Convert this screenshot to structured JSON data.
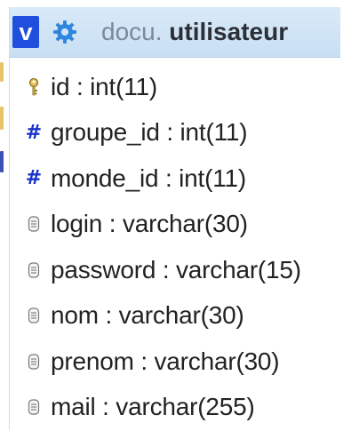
{
  "header": {
    "toggle_label": "v",
    "database": "docu.",
    "table": "utilisateur"
  },
  "columns": [
    {
      "text": "id : int(11)",
      "icon": "key-icon"
    },
    {
      "text": "groupe_id : int(11)",
      "icon": "numeric-icon"
    },
    {
      "text": "monde_id : int(11)",
      "icon": "numeric-icon"
    },
    {
      "text": "login : varchar(30)",
      "icon": "text-field-icon"
    },
    {
      "text": "password : varchar(15)",
      "icon": "text-field-icon"
    },
    {
      "text": "nom : varchar(30)",
      "icon": "text-field-icon"
    },
    {
      "text": "prenom : varchar(30)",
      "icon": "text-field-icon"
    },
    {
      "text": "mail : varchar(255)",
      "icon": "text-field-icon"
    }
  ],
  "colors": {
    "header_bg": "#c8dff3",
    "toggle_bg": "#1f4fdc",
    "gear": "#2f86de",
    "numeric": "#1a33c8"
  }
}
